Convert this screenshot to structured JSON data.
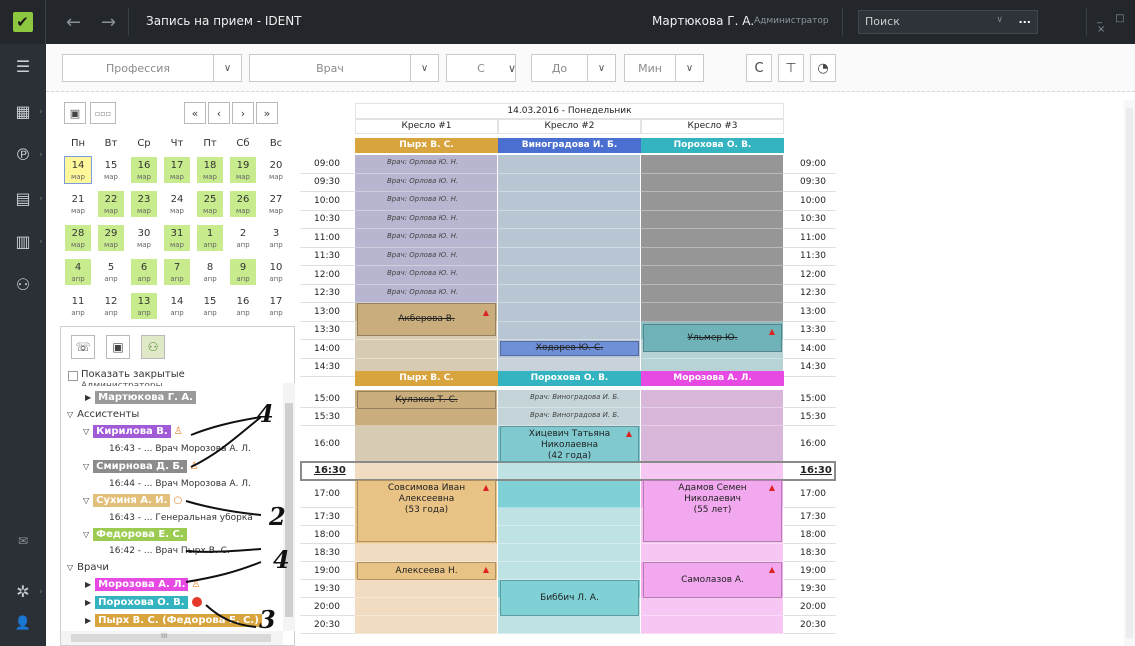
{
  "titlebar": {
    "logo_glyph": "✔",
    "back": "←",
    "forward": "→",
    "title": "Запись на прием - IDENT",
    "user": "Мартюкова Г. А.",
    "role": "Администратор",
    "search_placeholder": "Поиск",
    "search_chev": "∨",
    "search_more": "...",
    "window_controls": "_ □ ×"
  },
  "leftbar": {
    "icons": [
      {
        "name": "list-icon",
        "glyph": "☰"
      },
      {
        "name": "calendar-icon",
        "glyph": "▦"
      },
      {
        "name": "ruble-coin-icon",
        "glyph": "℗"
      },
      {
        "name": "cash-register-icon",
        "glyph": "▤"
      },
      {
        "name": "chart-icon",
        "glyph": "▥"
      },
      {
        "name": "users-icon",
        "glyph": "⚇"
      },
      {
        "name": "mail-icon",
        "glyph": "✉"
      },
      {
        "name": "gear-icon",
        "glyph": "✲"
      },
      {
        "name": "user-icon",
        "glyph": "👤"
      }
    ],
    "arrow": "›"
  },
  "filters": {
    "profession": "Профессия",
    "doctor": "Врач",
    "from": "С",
    "to": "До",
    "min": "Мин",
    "chev": "∨",
    "refresh": "C",
    "filter_clear": "⊤",
    "settings": "◔"
  },
  "calendar": {
    "today_btn": "▣",
    "dots_btn": "▫▫▫",
    "prev2": "«",
    "prev": "‹",
    "next": "›",
    "next2": "»",
    "dow": [
      "Пн",
      "Вт",
      "Ср",
      "Чт",
      "Пт",
      "Сб",
      "Вс"
    ],
    "weeks": [
      [
        [
          "14",
          "мар",
          "t"
        ],
        [
          "15",
          "мар",
          ""
        ],
        [
          "16",
          "мар",
          "g"
        ],
        [
          "17",
          "мар",
          "g"
        ],
        [
          "18",
          "мар",
          "g"
        ],
        [
          "19",
          "мар",
          "g"
        ],
        [
          "20",
          "мар",
          ""
        ]
      ],
      [
        [
          "21",
          "мар",
          ""
        ],
        [
          "22",
          "мар",
          "g"
        ],
        [
          "23",
          "мар",
          "g"
        ],
        [
          "24",
          "мар",
          ""
        ],
        [
          "25",
          "мар",
          "g"
        ],
        [
          "26",
          "мар",
          "g"
        ],
        [
          "27",
          "мар",
          ""
        ]
      ],
      [
        [
          "28",
          "мар",
          "g"
        ],
        [
          "29",
          "мар",
          "g"
        ],
        [
          "30",
          "мар",
          ""
        ],
        [
          "31",
          "мар",
          "g"
        ],
        [
          "1",
          "апр",
          "g"
        ],
        [
          "2",
          "апр",
          ""
        ],
        [
          "3",
          "апр",
          ""
        ]
      ],
      [
        [
          "4",
          "апр",
          "g"
        ],
        [
          "5",
          "апр",
          ""
        ],
        [
          "6",
          "апр",
          "g"
        ],
        [
          "7",
          "апр",
          "g"
        ],
        [
          "8",
          "апр",
          ""
        ],
        [
          "9",
          "апр",
          "g"
        ],
        [
          "10",
          "апр",
          ""
        ]
      ],
      [
        [
          "11",
          "апр",
          ""
        ],
        [
          "12",
          "апр",
          ""
        ],
        [
          "13",
          "апр",
          "g"
        ],
        [
          "14",
          "апр",
          ""
        ],
        [
          "15",
          "апр",
          ""
        ],
        [
          "16",
          "апр",
          ""
        ],
        [
          "17",
          "апр",
          ""
        ]
      ]
    ]
  },
  "tree": {
    "btn_phone": "☏",
    "btn_calendar": "▣",
    "btn_people": "⚇",
    "show_closed": "Показать закрытые",
    "partial_header": "Администраторы",
    "admin": "Мартюкова Г. А.",
    "assistants": "Ассистенты",
    "kirilova": "Кирилова В.",
    "kirilova_sub": "16:43 - ... Врач Морозова А. Л.",
    "smirnova": "Смирнова Д. Б.",
    "smirnova_sub": "16:44 - ... Врач Морозова А. Л.",
    "suhinya": "Сухиня А. И.",
    "suhinya_sub": "16:43 - ... Генеральная уборка",
    "fedorova": "Федорова Е. С.",
    "fedorova_sub": "16:42 - ... Врач Пырх В. С.",
    "doctors": "Врачи",
    "morozova": "Морозова А. Л.",
    "porohova": "Порохова О. В.",
    "pyrh": "Пырх В. С. (Федорова Е. С.)",
    "expand": "▶",
    "collapse": "▽",
    "hsb_grip": "III",
    "colors": {
      "kirilova": "#a25bd6",
      "smirnova": "#8c8c8c",
      "suhinya": "#e2bf7a",
      "fedorova": "#9ccb52",
      "morozova": "#e64ae3",
      "porohova": "#34b3c1",
      "pyrh": "#d8a43e",
      "admin": "#9a9a9a"
    },
    "handwritten": [
      "4",
      "2",
      "4",
      "3"
    ]
  },
  "schedule": {
    "date_header": "14.03.2016 - Понедельник",
    "chairs": [
      "Кресло #1",
      "Кресло #2",
      "Кресло #3"
    ],
    "doctors_top": [
      "Пырх В. С.",
      "Виноградова И. Б.",
      "Порохова О. В."
    ],
    "doctors_bottom": [
      "Пырх В. С.",
      "Порохова О. В.",
      "Морозова А. Л."
    ],
    "times_top": [
      "09:00",
      "09:30",
      "10:00",
      "10:30",
      "11:00",
      "11:30",
      "12:00",
      "12:30",
      "13:00",
      "13:30",
      "14:00",
      "14:30"
    ],
    "times_bottom": [
      "15:00",
      "15:30",
      "16:00",
      "16:30",
      "17:00",
      "17:30",
      "18:00",
      "18:30",
      "19:00",
      "19:30",
      "20:00",
      "20:30"
    ],
    "doctor_slot": "Врач: Орлова Ю. Н.",
    "vino_slot": "Врач: Виноградова И. Б.",
    "appts": {
      "akberova": "Акберова В.",
      "holdarev": "Ходарев Ю. С.",
      "ulmer": "Ульмер Ю.",
      "kulakov": "Кулаков Т. С.",
      "hitsevich": [
        "Хицевич Татьяна",
        "Николаевна",
        "(42 года)"
      ],
      "sosimova": [
        "Совсимова Иван",
        "Алексеевна",
        "(53 года)"
      ],
      "adamov": [
        "Адамов Семен",
        "Николаевич",
        "(55 лет)"
      ],
      "alekseeva": "Алексеева Н.",
      "bibbich": "Биббич Л. А.",
      "samolazov": "Самолазов А."
    },
    "colors": {
      "pyrh": "#d8a43e",
      "vino": "#4a6fd0",
      "porohova": "#34b3c1",
      "morozova": "#e64ae3"
    }
  }
}
